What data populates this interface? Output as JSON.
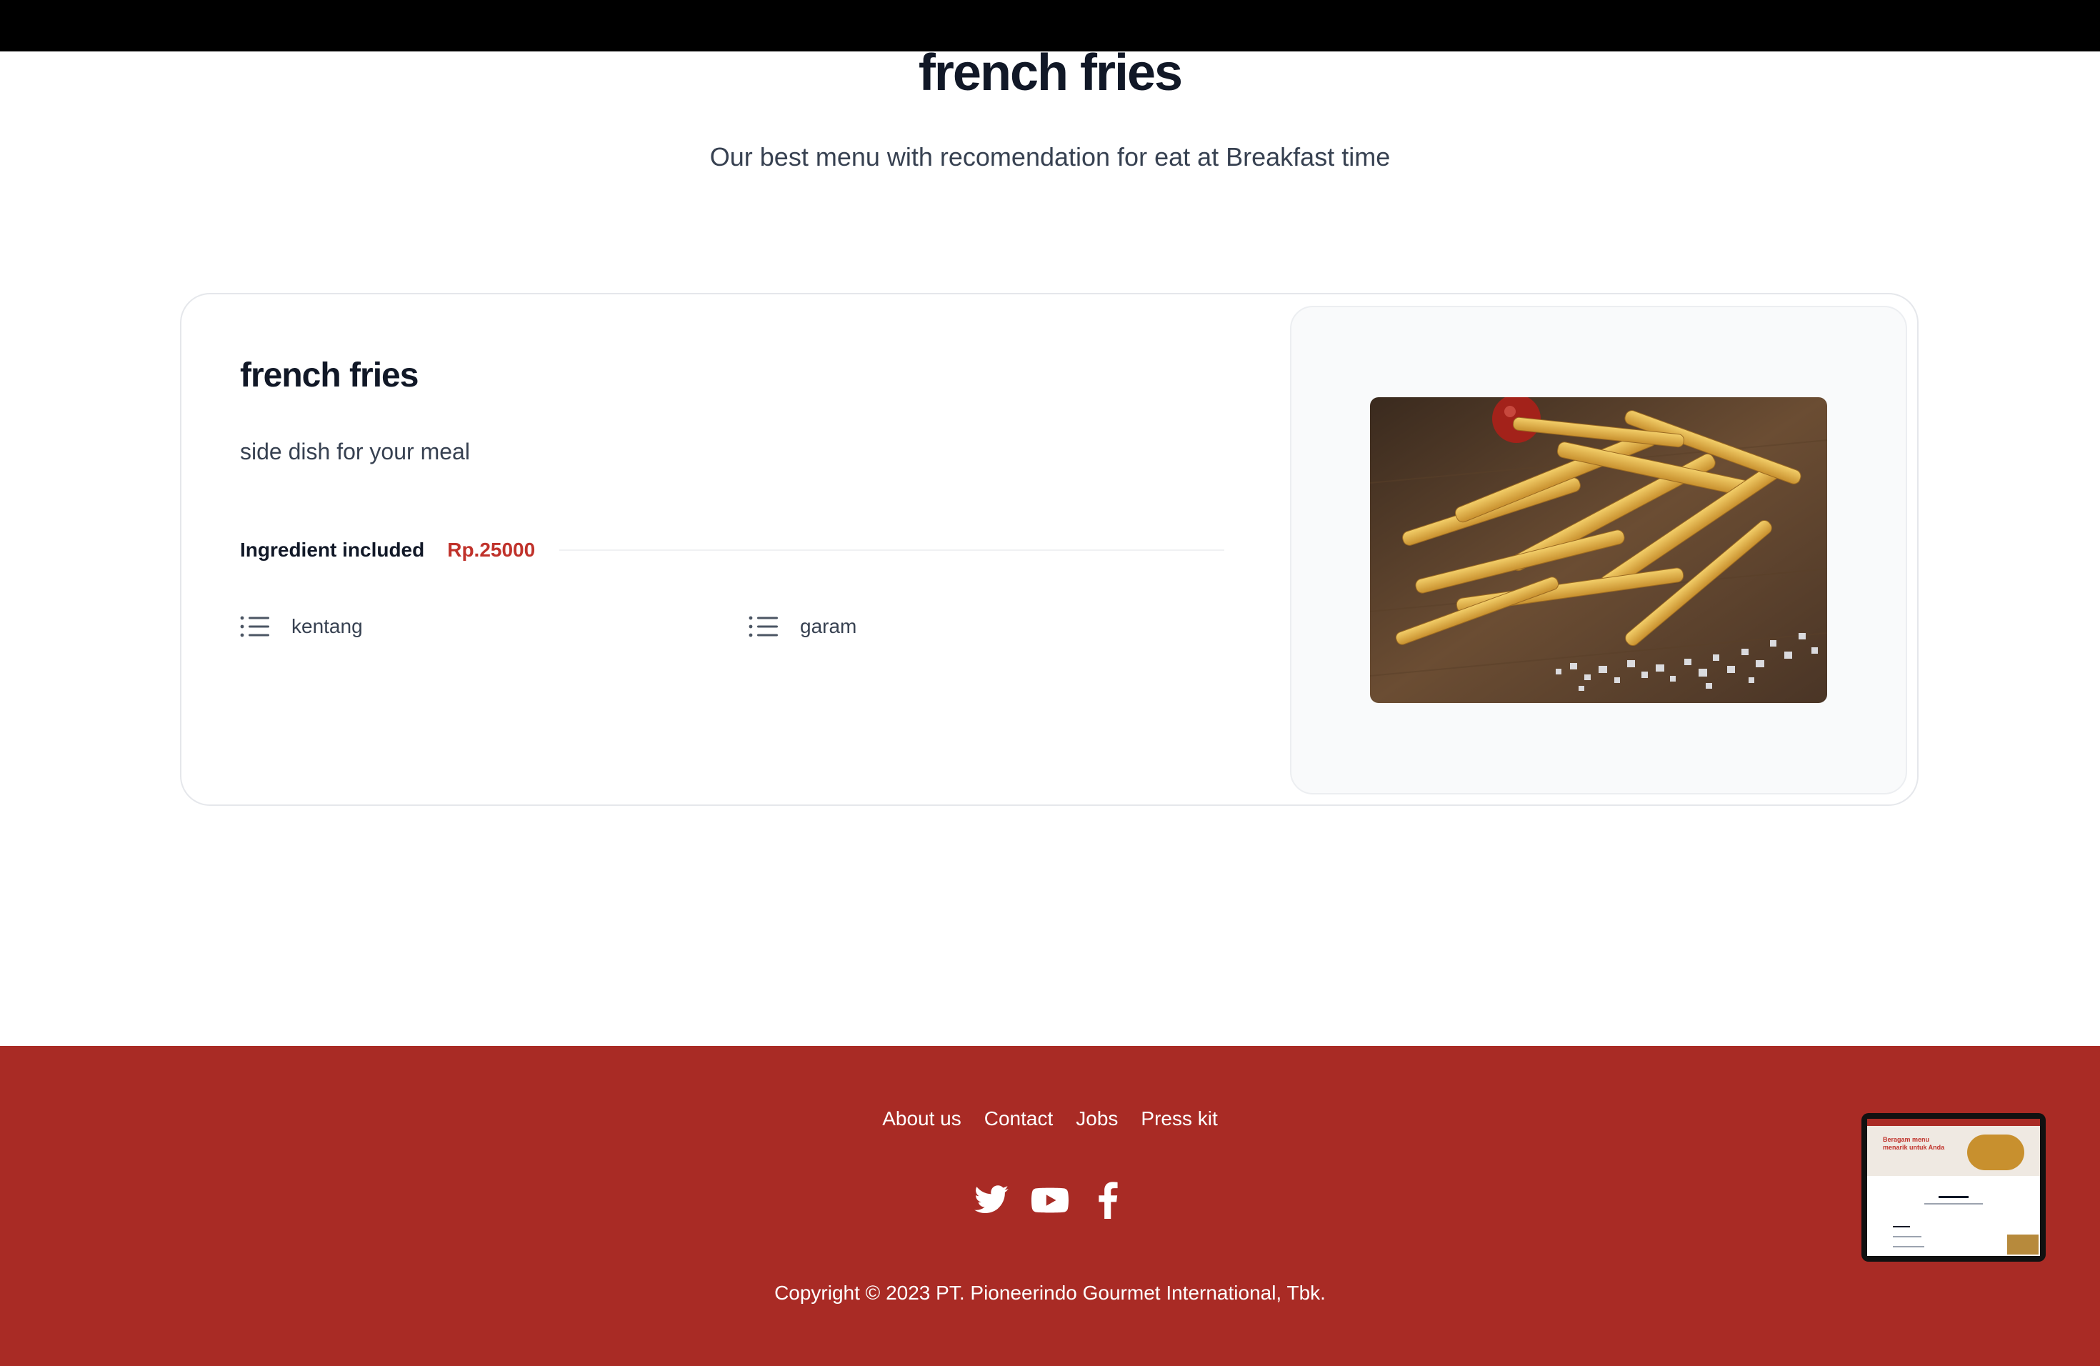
{
  "page": {
    "title": "french fries",
    "subtitle": "Our best menu with recomendation for eat at Breakfast time"
  },
  "card": {
    "name": "french fries",
    "description": "side dish for your meal",
    "ingredient_heading": "Ingredient included",
    "price": "Rp.25000",
    "ingredients": [
      {
        "label": "kentang",
        "icon": "list-icon"
      },
      {
        "label": "garam",
        "icon": "list-icon"
      }
    ],
    "image_alt": "french fries photo"
  },
  "footer": {
    "links": [
      "About us",
      "Contact",
      "Jobs",
      "Press kit"
    ],
    "social": [
      "twitter-icon",
      "youtube-icon",
      "facebook-icon"
    ],
    "copyright": "Copyright © 2023 PT. Pioneerindo Gourmet International, Tbk."
  },
  "thumbnail": {
    "banner_text": "Beragam menu menarik untuk Anda"
  },
  "colors": {
    "footer_bg": "#a92b25",
    "price": "#c0322b",
    "text_dark": "#111827",
    "text_muted": "#374151"
  }
}
